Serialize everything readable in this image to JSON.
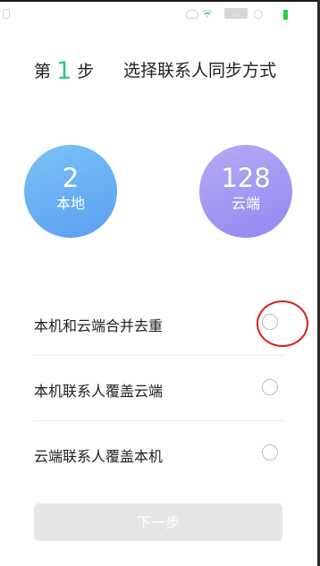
{
  "status_bar": {
    "signal_label": "..."
  },
  "header": {
    "step_prefix": "第",
    "step_number": "1",
    "step_suffix": "步",
    "title": "选择联系人同步方式"
  },
  "counts": {
    "local": {
      "count": "2",
      "label": "本地",
      "color": "#6aaef3"
    },
    "cloud": {
      "count": "128",
      "label": "云端",
      "color": "#a39cf3"
    }
  },
  "options": [
    {
      "label": "本机和云端合并去重",
      "selected": false
    },
    {
      "label": "本机联系人覆盖云端",
      "selected": false
    },
    {
      "label": "云端联系人覆盖本机",
      "selected": false
    }
  ],
  "next_button": {
    "label": "下一步",
    "enabled": false
  },
  "colors": {
    "accent_green": "#2fc48d",
    "annotation_red": "#d62020",
    "button_disabled": "#e6e6e6"
  }
}
